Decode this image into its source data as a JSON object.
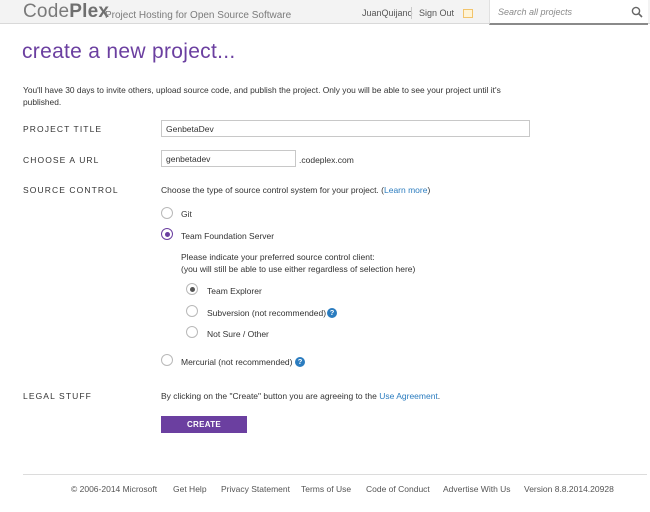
{
  "header": {
    "logo_prefix": "Code",
    "logo_suffix": "Plex",
    "tagline": "Project Hosting for Open Source Software",
    "username": "JuanQuijano",
    "sign_out": "Sign Out",
    "search_placeholder": "Search all projects"
  },
  "main": {
    "title": "create a new project...",
    "intro": "You'll have 30 days to invite others, upload source code, and publish the project. Only you will be able to see your project until it's published.",
    "project_title": {
      "label": "PROJECT TITLE",
      "value": "GenbetaDev"
    },
    "url": {
      "label": "CHOOSE A URL",
      "value": "genbetadev",
      "suffix": ".codeplex.com"
    },
    "source_control": {
      "label": "SOURCE CONTROL",
      "prompt": "Choose the type of source control system for your project. (",
      "learn_more": "Learn more",
      "prompt_end": ")",
      "options": [
        {
          "label": "Git",
          "checked": false
        },
        {
          "label": "Team Foundation Server",
          "checked": true
        },
        {
          "label": "Mercurial (not recommended)",
          "checked": false
        }
      ],
      "client_prompt_line1": "Please indicate your preferred source control client:",
      "client_prompt_line2": "(you will still be able to use either regardless of selection here)",
      "client_options": [
        {
          "label": "Team Explorer",
          "checked": true
        },
        {
          "label": "Subversion (not recommended)",
          "checked": false
        },
        {
          "label": "Not Sure / Other",
          "checked": false
        }
      ],
      "help_glyph": "?"
    },
    "legal": {
      "label": "LEGAL STUFF",
      "text": "By clicking on the \"Create\" button you are agreeing to the ",
      "link": "Use Agreement",
      "text_end": "."
    },
    "create_button": "CREATE"
  },
  "footer": {
    "copyright": "© 2006-2014 Microsoft",
    "links": [
      "Get Help",
      "Privacy Statement",
      "Terms of Use",
      "Code of Conduct",
      "Advertise With Us"
    ],
    "version": "Version 8.8.2014.20928"
  },
  "colors": {
    "accent": "#6b3fa0",
    "link": "#2b7cbf",
    "header_bg": "#f3f3f3"
  }
}
